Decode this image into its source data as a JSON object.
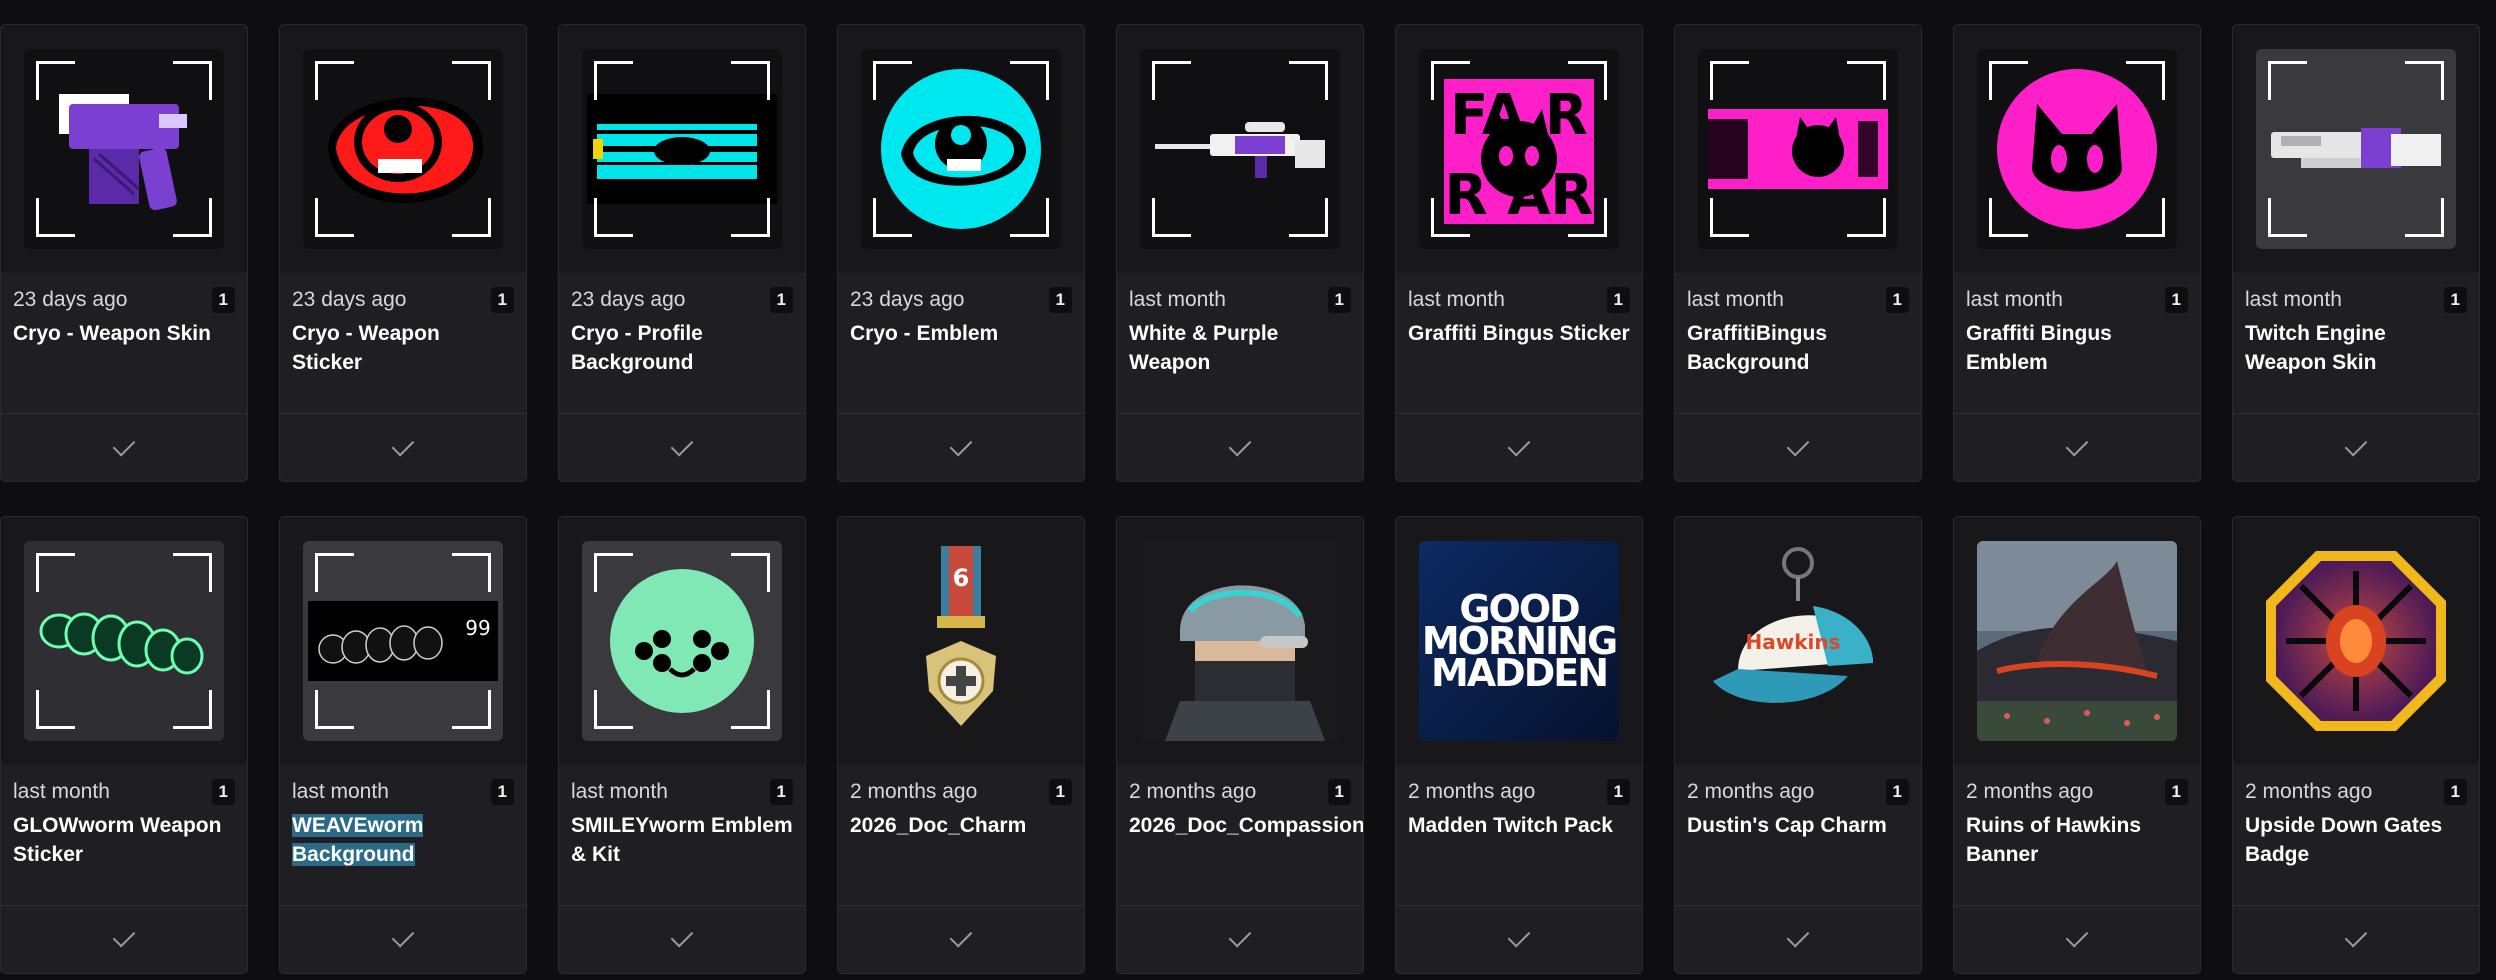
{
  "items": [
    {
      "date": "23 days ago",
      "quantity": "1",
      "name": "Cryo - Weapon Skin",
      "icon": "purple-pistol-icon",
      "framed": true,
      "thumb_bg": "#101012"
    },
    {
      "date": "23 days ago",
      "quantity": "1",
      "name": "Cryo - Weapon Sticker",
      "icon": "red-eye-sticker-icon",
      "framed": true,
      "thumb_bg": "#101012"
    },
    {
      "date": "23 days ago",
      "quantity": "1",
      "name": "Cryo - Profile Background",
      "icon": "cyan-glitch-background-icon",
      "framed": true,
      "thumb_bg": "#101012"
    },
    {
      "date": "23 days ago",
      "quantity": "1",
      "name": "Cryo - Emblem",
      "icon": "cyan-eye-emblem-icon",
      "framed": true,
      "thumb_bg": "#101012"
    },
    {
      "date": "last month",
      "quantity": "1",
      "name": "White & Purple Weapon",
      "icon": "purple-rifle-icon",
      "framed": true,
      "thumb_bg": "#101012"
    },
    {
      "date": "last month",
      "quantity": "1",
      "name": "Graffiti Bingus Sticker",
      "icon": "pink-graffiti-sticker-icon",
      "framed": true,
      "thumb_bg": "#101012"
    },
    {
      "date": "last month",
      "quantity": "1",
      "name": "GraffitiBingus Background",
      "icon": "pink-graffiti-background-icon",
      "framed": true,
      "thumb_bg": "#101012"
    },
    {
      "date": "last month",
      "quantity": "1",
      "name": "Graffiti Bingus Emblem",
      "icon": "pink-cat-emblem-icon",
      "framed": true,
      "thumb_bg": "#101012"
    },
    {
      "date": "last month",
      "quantity": "1",
      "name": "Twitch Engine Weapon Skin",
      "icon": "white-shotgun-icon",
      "framed": true,
      "thumb_bg": "#3a3a3e"
    },
    {
      "date": "last month",
      "quantity": "1",
      "name": "GLOWworm Weapon Sticker",
      "icon": "green-worm-sticker-icon",
      "framed": true,
      "thumb_bg": "#2e2e33"
    },
    {
      "date": "last month",
      "quantity": "1",
      "name": "WEAVEworm Background",
      "name_highlight": true,
      "icon": "worm-background-icon",
      "framed": true,
      "thumb_bg": "#3a3a3e"
    },
    {
      "date": "last month",
      "quantity": "1",
      "name": "SMILEYworm Emblem & Kit",
      "icon": "smiley-face-emblem-icon",
      "framed": true,
      "thumb_bg": "#3a3a3e"
    },
    {
      "date": "2 months ago",
      "quantity": "1",
      "name": "2026_Doc_Charm",
      "icon": "medal-charm-icon",
      "framed": false,
      "thumb_bg": "transparent"
    },
    {
      "date": "2 months ago",
      "quantity": "1",
      "name": "2026_Doc_Compassion",
      "icon": "operator-helmet-icon",
      "framed": false,
      "thumb_bg": "transparent"
    },
    {
      "date": "2 months ago",
      "quantity": "1",
      "name": "Madden Twitch Pack",
      "icon": "good-morning-madden-icon",
      "framed": false,
      "thumb_bg": "#0a1f4a",
      "art_text": [
        "GOOD",
        "MORNING",
        "MADDEN"
      ]
    },
    {
      "date": "2 months ago",
      "quantity": "1",
      "name": "Dustin's Cap Charm",
      "icon": "cap-charm-icon",
      "framed": false,
      "thumb_bg": "transparent"
    },
    {
      "date": "2 months ago",
      "quantity": "1",
      "name": "Ruins of Hawkins Banner",
      "icon": "hawkins-landscape-icon",
      "framed": false,
      "thumb_bg": "transparent"
    },
    {
      "date": "2 months ago",
      "quantity": "1",
      "name": "Upside Down Gates Badge",
      "icon": "octagon-vine-badge-icon",
      "framed": false,
      "thumb_bg": "transparent"
    }
  ],
  "colors": {
    "page_bg": "#0e0e10",
    "card_bg": "#1f1f23",
    "highlight": "#2b6b88"
  }
}
